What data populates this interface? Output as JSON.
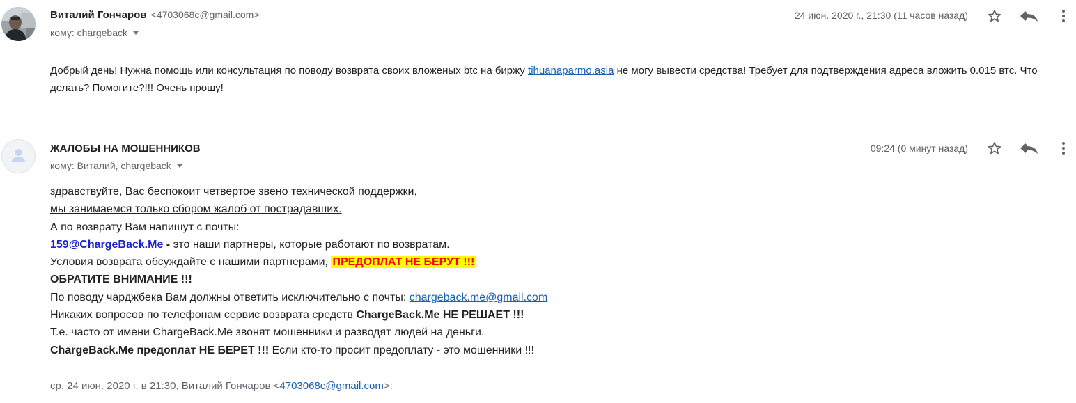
{
  "messages": [
    {
      "sender_name": "Виталий Гончаров",
      "sender_email": "<4703068c@gmail.com>",
      "to": "кому: chargeback",
      "date": "24 июн. 2020 г., 21:30 (11 часов назад)",
      "body_part1": "Добрый день! Нужна помощь или консультация по поводу возврата своих вложеных btc на биржу ",
      "body_link": "tihuanaparmo.asia",
      "body_part2": " не могу вывести средства! Требует для подтверждения адреса вложить 0.015 втс. Что делать? Помогите?!!! Очень прошу!"
    },
    {
      "sender_name": "ЖАЛОБЫ НА МОШЕННИКОВ",
      "to": "кому: Виталий, chargeback",
      "date": "09:24 (0 минут назад)",
      "lines": {
        "l1": "здравствуйте, Вас беспокоит четвертое звено технической поддержки,",
        "l2": "мы занимаемся только сбором жалоб от пострадавших.",
        "l3": "А по возврату Вам напишут с почты:",
        "l4_email": "159@ChargeBack.Me",
        "l4_dash": " - ",
        "l4_rest": "это наши партнеры, которые работают по возвратам.",
        "l5_text": "Условия возврата обсуждайте с нашими партнерами, ",
        "l5_highlight": "ПРЕДОПЛАТ НЕ БЕРУТ !!!",
        "l6": "ОБРАТИТЕ ВНИМАНИЕ !!!",
        "l7_text": "По поводу чарджбека Вам должны ответить исключительно с почты: ",
        "l7_link": "chargeback.me@gmail.com",
        "l8_text": "Никаких вопросов по телефонам сервис возврата средств ",
        "l8_bold": "ChargeBack.Me НЕ РЕШАЕТ !!!",
        "l9": "Т.е. часто от имени ChargeBack.Me звонят мошенники и разводят людей на деньги.",
        "l10_bold": "ChargeBack.Me предоплат НЕ БЕРЕТ !!!",
        "l10_text": " Если кто-то просит предоплату ",
        "l10_dash": "-",
        "l10_rest": " это мошенники !!!"
      },
      "quote_prefix": "ср, 24 июн. 2020 г. в 21:30, Виталий Гончаров <",
      "quote_email": "4703068c@gmail.com",
      "quote_suffix": ">:"
    }
  ],
  "icons": {
    "star": "star-icon",
    "reply": "reply-all-icon",
    "more": "more-vertical-icon",
    "dropdown": "chevron-down-icon"
  },
  "colors": {
    "link": "#1a5fb4",
    "email_blue": "#1a24c8",
    "highlight_bg": "#ffff00",
    "highlight_text": "#ff0000",
    "muted": "#5f6368"
  }
}
